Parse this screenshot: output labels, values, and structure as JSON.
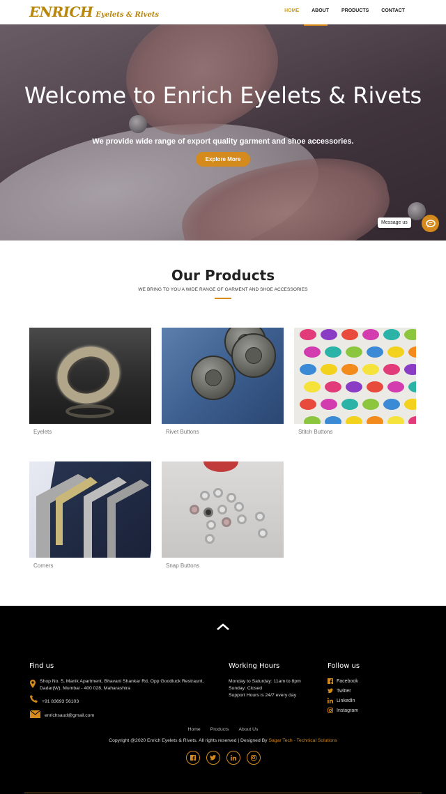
{
  "brand": {
    "logo_main": "ENRICH",
    "logo_sub": "Eyelets & Rivets",
    "accent": "#d48a1c"
  },
  "nav": {
    "items": [
      {
        "label": "HOME",
        "active": true
      },
      {
        "label": "ABOUT"
      },
      {
        "label": "PRODUCTS"
      },
      {
        "label": "CONTACT"
      }
    ]
  },
  "hero": {
    "title": "Welcome to Enrich Eyelets & Rivets",
    "subtitle": "We provide wide range of export quality garment and shoe accessories.",
    "button": "Explore More"
  },
  "chat": {
    "label": "Message us",
    "icon": "chat-bubble-icon"
  },
  "products": {
    "title": "Our Products",
    "subtitle": "WE BRING TO YOU A WIDE RANGE OF GARMENT AND SHOE ACCESSORIES",
    "items": [
      {
        "label": "Eyelets"
      },
      {
        "label": "Rivet Buttons"
      },
      {
        "label": "Stitch Buttons"
      },
      {
        "label": "Corners"
      },
      {
        "label": "Snap Buttons"
      }
    ]
  },
  "footer": {
    "find_us": {
      "title": "Find us",
      "address_line1": "Shop No. 5, Manik Apartment, Bhavani Shankar Rd, Opp Goodluck Restraunt,",
      "address_line2": "Dadar(W), Mumbai - 400 028, Maharashtra",
      "phone": "+91 83693 56103",
      "email": "enrichsaud@gmail.com"
    },
    "hours": {
      "title": "Working Hours",
      "line1": "Monday to Saturday: 11am to 8pm",
      "line2": "Sunday: Closed",
      "line3": "Support Hours is 24/7 every day"
    },
    "follow": {
      "title": "Follow us",
      "items": [
        {
          "label": "Facebook",
          "icon": "facebook-icon"
        },
        {
          "label": "Twitter",
          "icon": "twitter-icon"
        },
        {
          "label": "LinkedIn",
          "icon": "linkedin-icon"
        },
        {
          "label": "Instagram",
          "icon": "instagram-icon"
        }
      ]
    },
    "links": [
      "Home",
      "Products",
      "About Us"
    ],
    "copyright": "Copyright @2020 Enrich Eyelets & Rivets. All rights reserved | Designed By",
    "designer": "Sagar Tech - Technical Solutions"
  }
}
